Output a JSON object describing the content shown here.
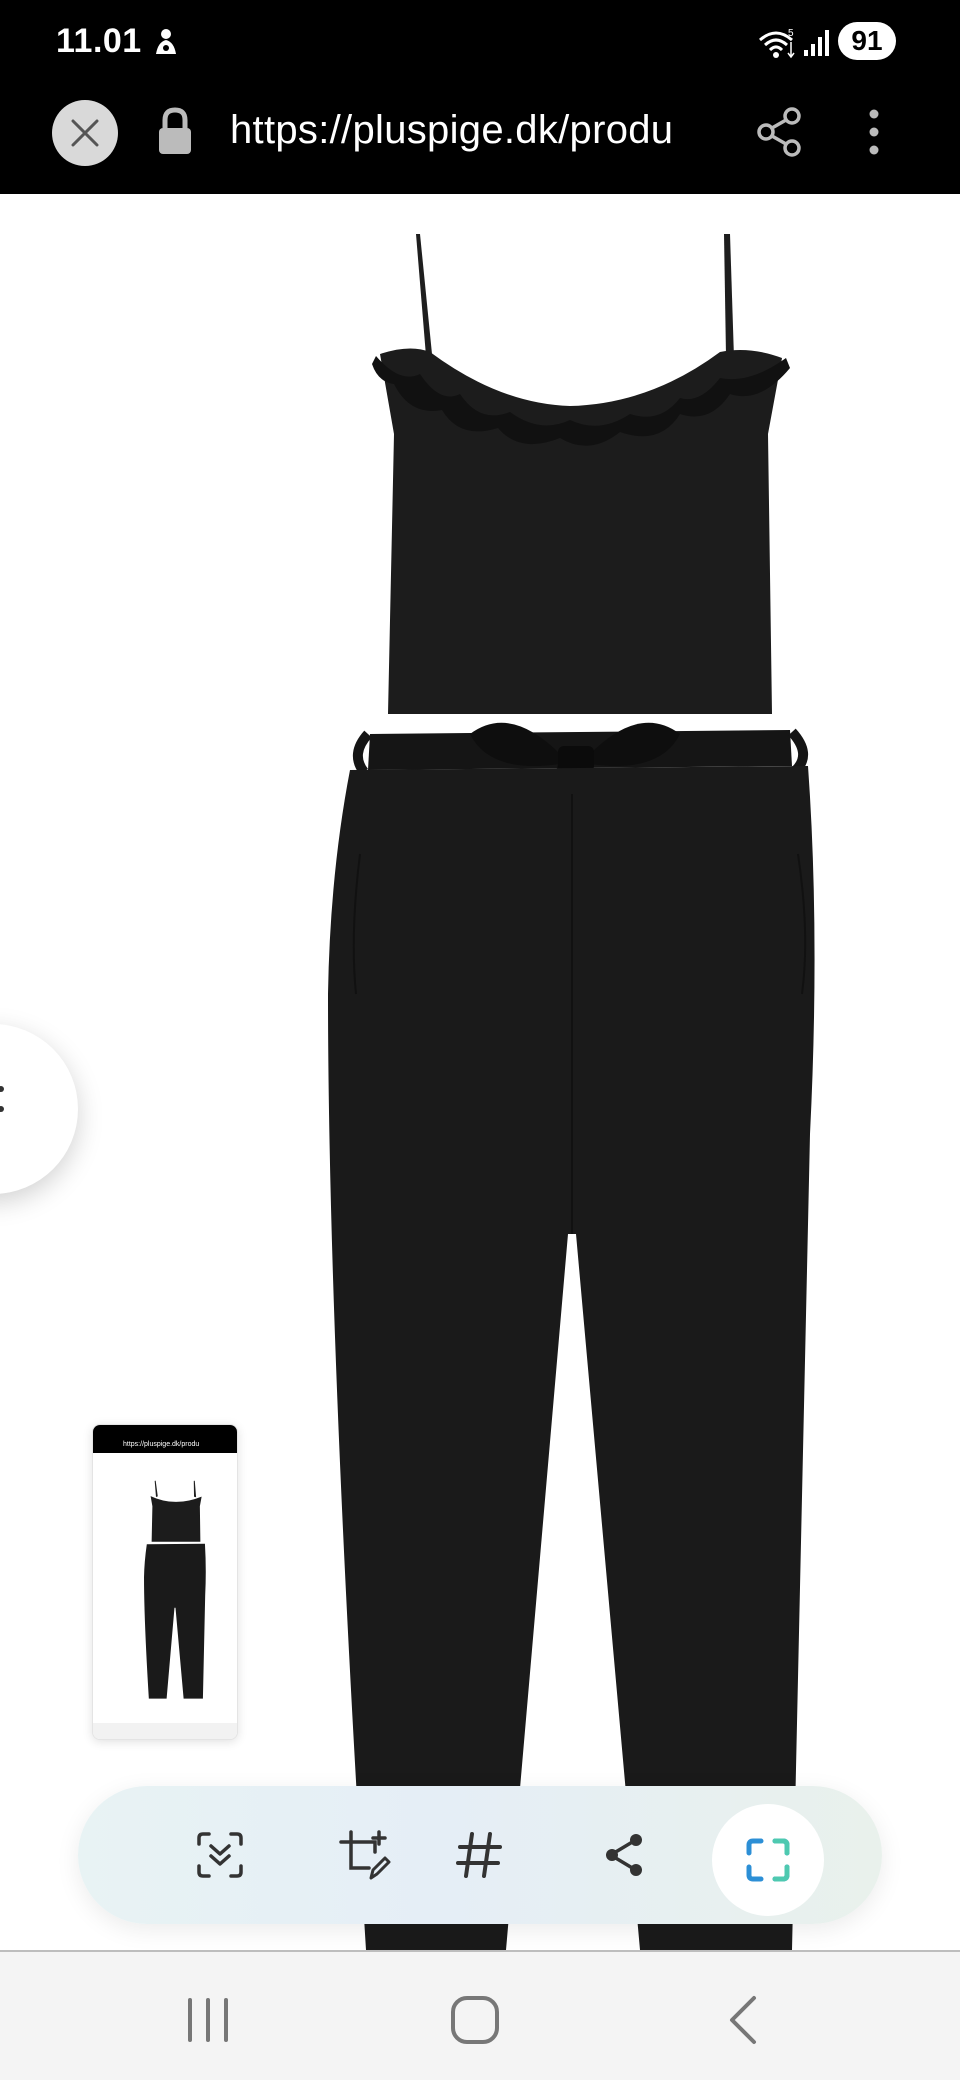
{
  "status_bar": {
    "time": "11.01",
    "battery": "91",
    "icons": [
      "notification-icon",
      "wifi-icon",
      "signal-icon",
      "battery-icon"
    ]
  },
  "browser": {
    "url": "https://pluspige.dk/produ",
    "icons": [
      "close-icon",
      "lock-icon",
      "share-icon",
      "more-vert-icon"
    ]
  },
  "product": {
    "image": "black-jumpsuit-photo",
    "color": "#1a1a1a"
  },
  "thumbnail": {
    "url_text": "https://pluspige.dk/produ"
  },
  "toolbar": {
    "items": [
      "scan-text-icon",
      "crop-edit-icon",
      "hashtag-icon",
      "share-icon",
      "screenshot-expand-icon"
    ],
    "accent": "#2c8fd6"
  },
  "nav": {
    "items": [
      "recent-apps-icon",
      "home-icon",
      "back-icon"
    ]
  }
}
